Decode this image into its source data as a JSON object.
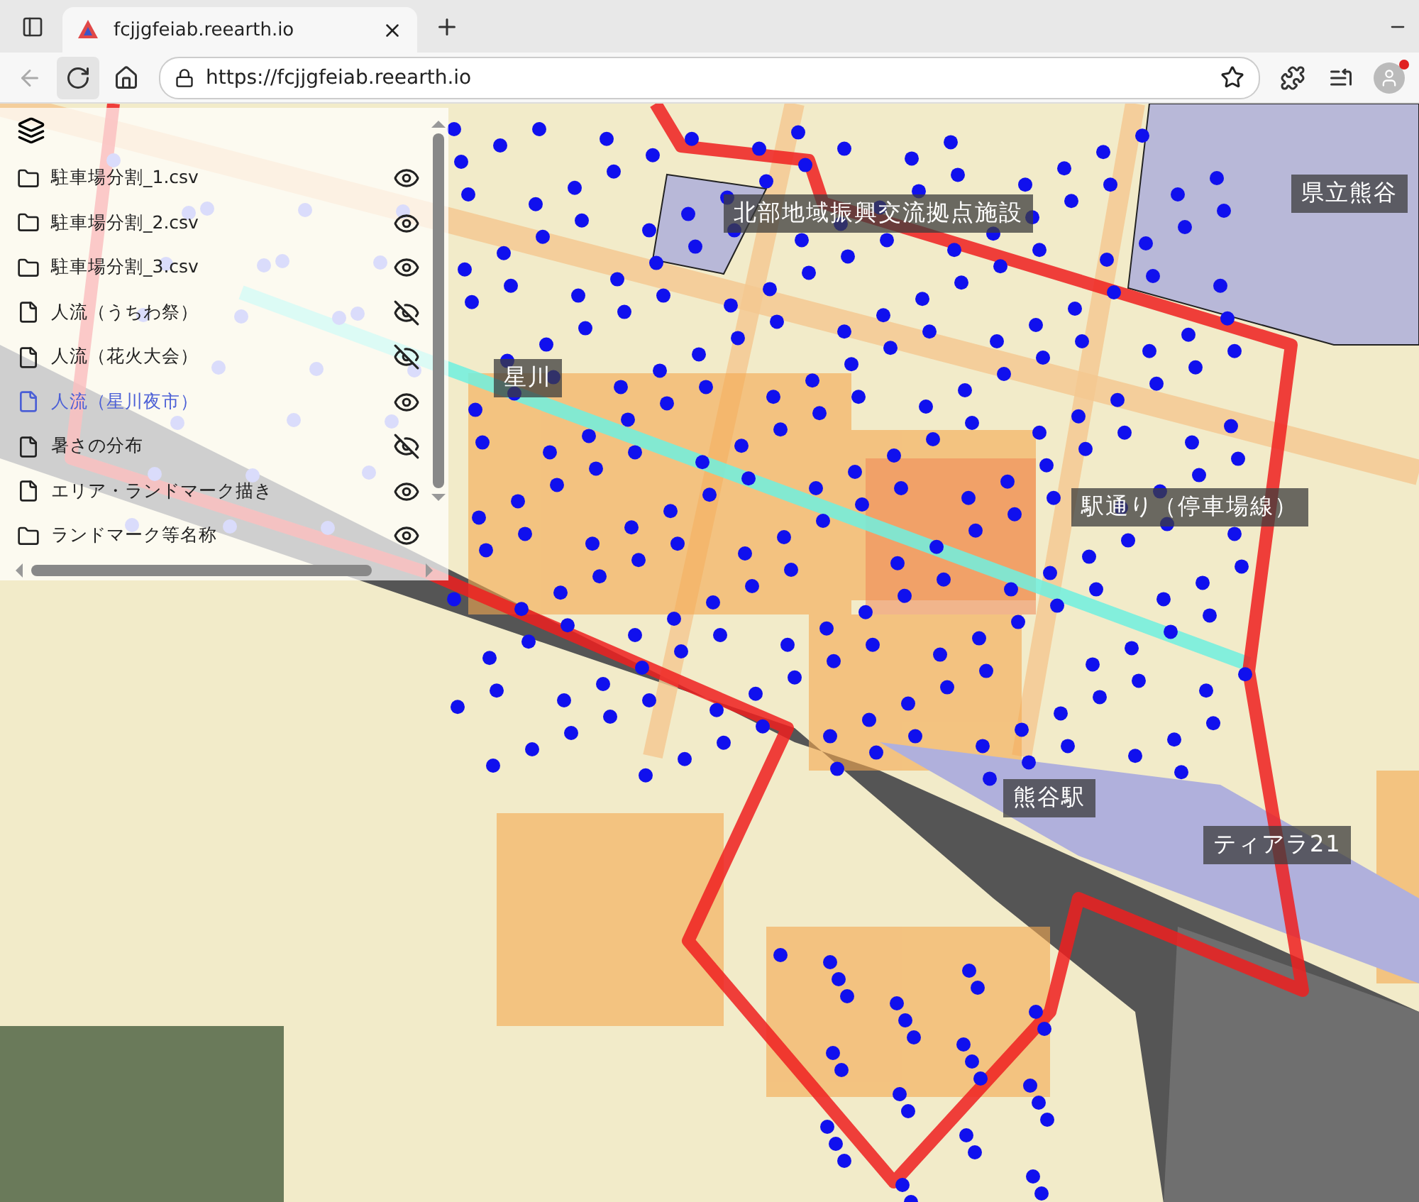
{
  "browser": {
    "tab_title": "fcjjgfeiab.reearth.io",
    "url": "https://fcjjgfeiab.reearth.io"
  },
  "layers": [
    {
      "kind": "folder",
      "label": "駐車場分割_1.csv",
      "visible": true,
      "selected": false
    },
    {
      "kind": "folder",
      "label": "駐車場分割_2.csv",
      "visible": true,
      "selected": false
    },
    {
      "kind": "folder",
      "label": "駐車場分割_3.csv",
      "visible": true,
      "selected": false
    },
    {
      "kind": "file",
      "label": "人流（うちわ祭）",
      "visible": false,
      "selected": false
    },
    {
      "kind": "file",
      "label": "人流（花火大会）",
      "visible": false,
      "selected": false
    },
    {
      "kind": "file",
      "label": "人流（星川夜市）",
      "visible": true,
      "selected": true
    },
    {
      "kind": "file",
      "label": "暑さの分布",
      "visible": false,
      "selected": false
    },
    {
      "kind": "file",
      "label": "エリア・ランドマーク描き",
      "visible": true,
      "selected": false
    },
    {
      "kind": "folder",
      "label": "ランドマーク等名称",
      "visible": true,
      "selected": false
    }
  ],
  "map_labels": [
    {
      "text": "北部地域振興交流拠点施設"
    },
    {
      "text": "県立熊谷"
    },
    {
      "text": "星川"
    },
    {
      "text": "駅通り（停車場線）"
    },
    {
      "text": "熊谷駅"
    },
    {
      "text": "ティアラ21"
    }
  ]
}
